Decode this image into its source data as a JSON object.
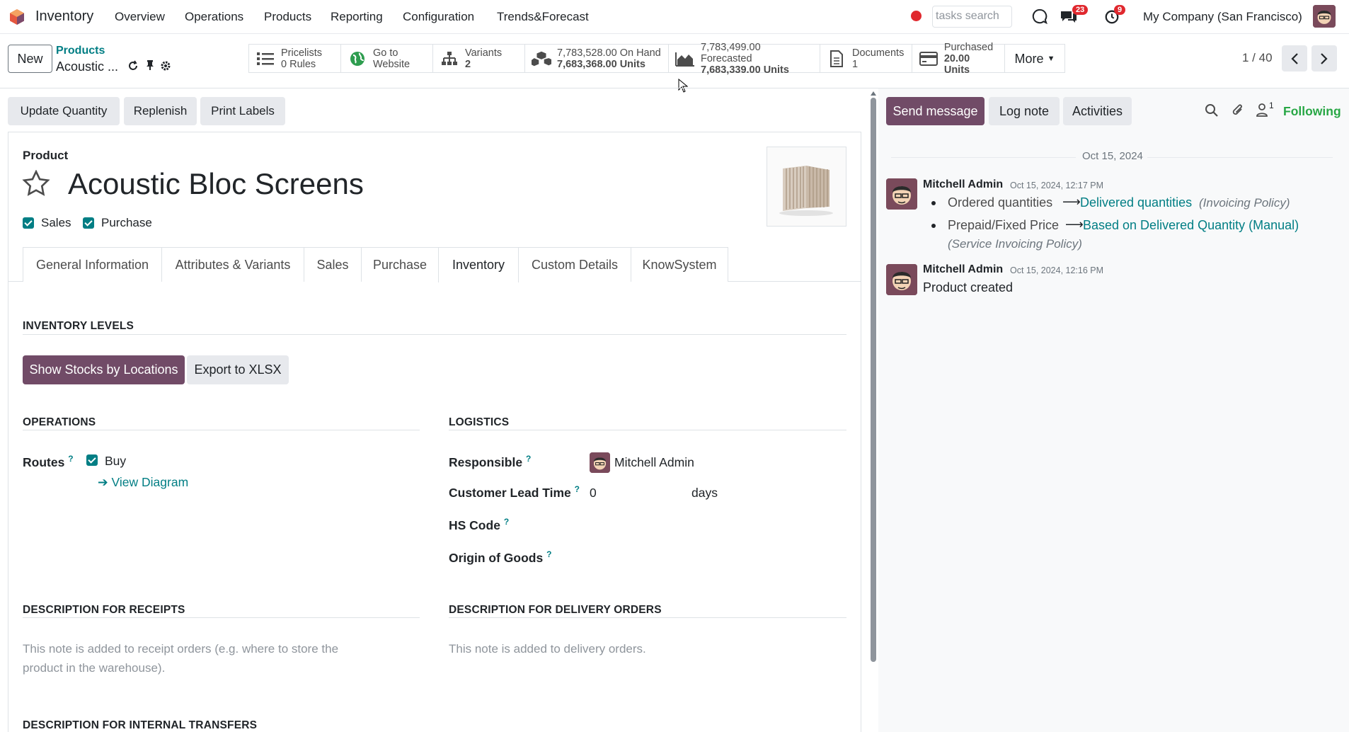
{
  "nav": {
    "app_name": "Inventory",
    "menus": [
      "Overview",
      "Operations",
      "Products",
      "Reporting",
      "Configuration",
      "Trends&Forecast"
    ],
    "search_placeholder": "tasks search",
    "chat_badge": "23",
    "activity_badge": "9",
    "company": "My Company (San Francisco)"
  },
  "control": {
    "new_label": "New",
    "breadcrumb_parent": "Products",
    "breadcrumb_current": "Acoustic ...",
    "pager": "1 / 40",
    "more_label": "More"
  },
  "smart_buttons": [
    {
      "line1": "Pricelists",
      "line2": "0 Rules",
      "icon": "list-icon"
    },
    {
      "line1": "Go to",
      "line2": "Website",
      "icon": "globe-icon"
    },
    {
      "line1": "Variants",
      "line2": "2",
      "icon": "sitemap-icon"
    },
    {
      "line1": "7,783,528.00 On Hand",
      "line2": "7,683,368.00 Units",
      "icon": "cubes-icon"
    },
    {
      "line1": "7,783,499.00 Forecasted",
      "line2": "7,683,339.00 Units",
      "icon": "area-chart-icon"
    },
    {
      "line1": "Documents",
      "line2": "1",
      "icon": "file-icon"
    },
    {
      "line1": "Purchased",
      "line2": "20.00 Units",
      "icon": "credit-card-icon"
    }
  ],
  "statusbar": {
    "update_qty": "Update Quantity",
    "replenish": "Replenish",
    "print_labels": "Print Labels"
  },
  "product": {
    "label": "Product",
    "name": "Acoustic Bloc Screens",
    "sales_label": "Sales",
    "purchase_label": "Purchase"
  },
  "tabs": [
    "General Information",
    "Attributes & Variants",
    "Sales",
    "Purchase",
    "Inventory",
    "Custom Details",
    "KnowSystem"
  ],
  "inventory": {
    "levels_title": "INVENTORY LEVELS",
    "show_stocks": "Show Stocks by Locations",
    "export_xlsx": "Export to XLSX",
    "operations_title": "OPERATIONS",
    "logistics_title": "LOGISTICS",
    "routes_label": "Routes",
    "route_buy": "Buy",
    "view_diagram": "View Diagram",
    "responsible_label": "Responsible",
    "responsible_value": "Mitchell Admin",
    "lead_time_label": "Customer Lead Time",
    "lead_time_value": "0",
    "lead_time_unit": "days",
    "hs_code_label": "HS Code",
    "origin_label": "Origin of Goods",
    "desc_receipts_title": "DESCRIPTION FOR RECEIPTS",
    "desc_receipts_placeholder": "This note is added to receipt orders (e.g. where to store the product in the warehouse).",
    "desc_delivery_title": "DESCRIPTION FOR DELIVERY ORDERS",
    "desc_delivery_placeholder": "This note is added to delivery orders.",
    "desc_internal_title": "DESCRIPTION FOR INTERNAL TRANSFERS",
    "help_mark": "?"
  },
  "chatter": {
    "send_message": "Send message",
    "log_note": "Log note",
    "activities": "Activities",
    "followers_count": "1",
    "following": "Following",
    "date_separator": "Oct 15, 2024",
    "messages": [
      {
        "author": "Mitchell Admin",
        "date": "Oct 15, 2024, 12:17 PM",
        "changes": [
          {
            "old": "Ordered quantities",
            "new": "Delivered quantities",
            "field": "(Invoicing Policy)"
          },
          {
            "old": "Prepaid/Fixed Price",
            "new": "Based on Delivered Quantity (Manual)",
            "field": "(Service Invoicing Policy)"
          }
        ]
      },
      {
        "author": "Mitchell Admin",
        "date": "Oct 15, 2024, 12:16 PM",
        "body": "Product created"
      }
    ]
  },
  "colors": {
    "primary": "#714b67",
    "link": "#017e84",
    "following": "#28a745",
    "badge": "#e0282e"
  }
}
